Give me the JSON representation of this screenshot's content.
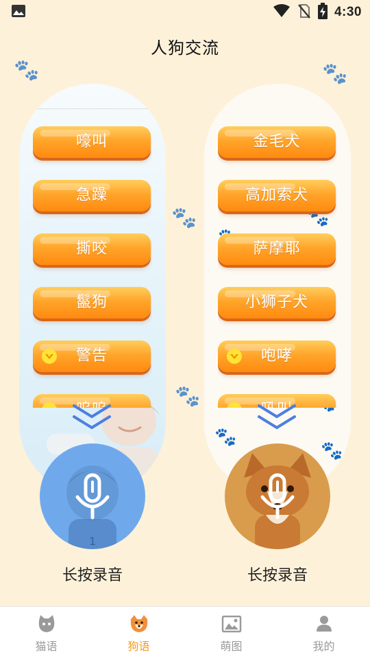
{
  "status_bar": {
    "time": "4:30",
    "icons": [
      "gallery-icon",
      "wifi-icon",
      "no-sim-icon",
      "battery-charging-icon"
    ]
  },
  "page": {
    "title": "人狗交流"
  },
  "left_panel": {
    "buttons": [
      {
        "label": "嚎叫",
        "vip": false
      },
      {
        "label": "急躁",
        "vip": false
      },
      {
        "label": "撕咬",
        "vip": false
      },
      {
        "label": "鬣狗",
        "vip": false
      },
      {
        "label": "警告",
        "vip": true
      },
      {
        "label": "呜呜",
        "vip": true
      }
    ],
    "record_label": "长按录音"
  },
  "right_panel": {
    "buttons": [
      {
        "label": "金毛犬",
        "vip": false
      },
      {
        "label": "高加索犬",
        "vip": false
      },
      {
        "label": "萨摩耶",
        "vip": false
      },
      {
        "label": "小狮子犬",
        "vip": false
      },
      {
        "label": "咆哮",
        "vip": true
      },
      {
        "label": "吼叫",
        "vip": true
      }
    ],
    "record_label": "长按录音"
  },
  "bottom_nav": {
    "items": [
      {
        "label": "猫语",
        "icon": "cat-icon",
        "active": false
      },
      {
        "label": "狗语",
        "icon": "dog-icon",
        "active": true
      },
      {
        "label": "萌图",
        "icon": "image-icon",
        "active": false
      },
      {
        "label": "我的",
        "icon": "user-icon",
        "active": false
      }
    ]
  },
  "colors": {
    "background": "#fdf1d9",
    "button_orange": "#ff9a1f",
    "mic_left": "#6fa9ec",
    "mic_right": "#d99c4d",
    "nav_active": "#f59a1a",
    "nav_inactive": "#9a9a9a",
    "chevron": "#4d7fe0"
  }
}
